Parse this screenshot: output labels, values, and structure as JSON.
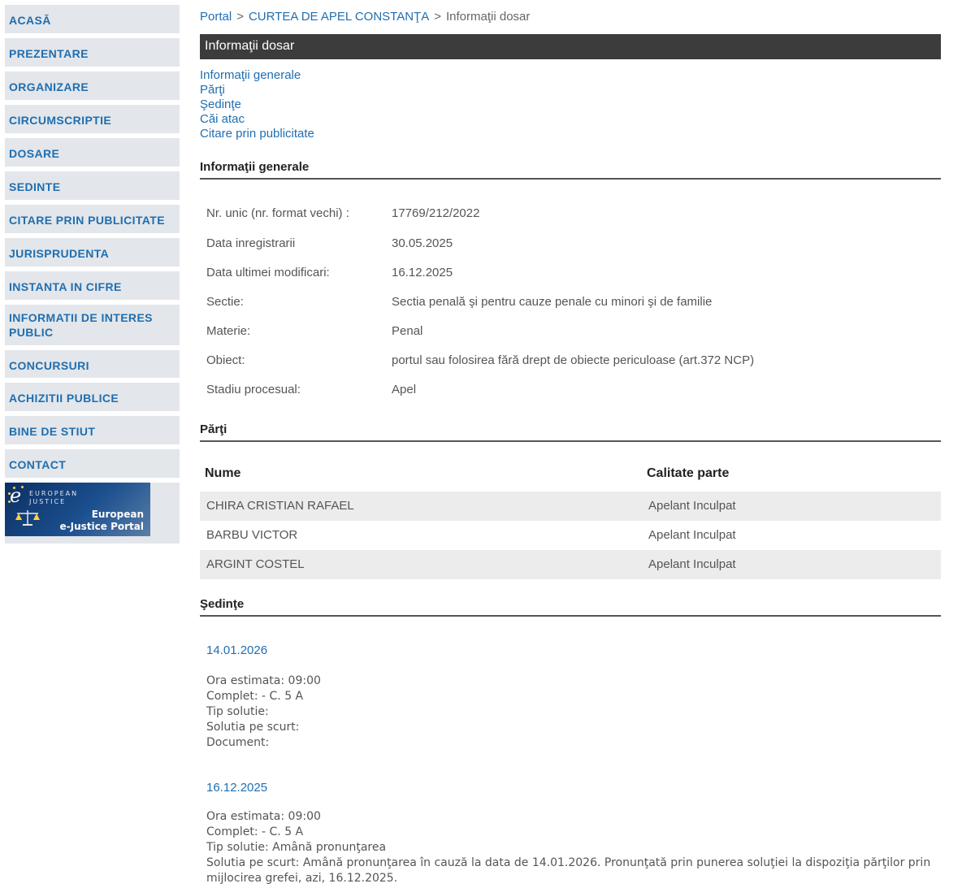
{
  "sidebar": {
    "items": [
      {
        "label": "ACASĂ"
      },
      {
        "label": "PREZENTARE"
      },
      {
        "label": "ORGANIZARE"
      },
      {
        "label": "CIRCUMSCRIPTIE"
      },
      {
        "label": "DOSARE"
      },
      {
        "label": "SEDINTE"
      },
      {
        "label": "CITARE PRIN PUBLICITATE"
      },
      {
        "label": "JURISPRUDENTA"
      },
      {
        "label": "INSTANTA IN CIFRE"
      },
      {
        "label": "INFORMATII DE INTERES PUBLIC"
      },
      {
        "label": "CONCURSURI"
      },
      {
        "label": "ACHIZITII PUBLICE"
      },
      {
        "label": "BINE DE STIUT"
      },
      {
        "label": "CONTACT"
      }
    ],
    "banner": {
      "line_small_1": "EUROPEAN",
      "line_small_2": "JUSTICE",
      "line1": "European",
      "line2": "e-Justice Portal"
    }
  },
  "breadcrumb": {
    "portal": "Portal",
    "court": "CURTEA DE APEL CONSTANŢA",
    "current": "Informaţii dosar",
    "separator": ">"
  },
  "page_title": "Informaţii dosar",
  "section_links": [
    "Informaţii generale",
    "Părţi",
    "Şedinţe",
    "Căi atac",
    "Citare prin publicitate"
  ],
  "general": {
    "heading": "Informaţii generale",
    "rows": [
      {
        "label": "Nr. unic (nr. format vechi) :",
        "value": "17769/212/2022"
      },
      {
        "label": "Data inregistrarii",
        "value": "30.05.2025"
      },
      {
        "label": "Data ultimei modificari:",
        "value": "16.12.2025"
      },
      {
        "label": "Sectie:",
        "value": "Sectia penală şi pentru cauze penale cu minori şi de familie"
      },
      {
        "label": "Materie:",
        "value": "Penal"
      },
      {
        "label": "Obiect:",
        "value": "portul sau folosirea fără drept de obiecte periculoase (art.372 NCP)"
      },
      {
        "label": "Stadiu procesual:",
        "value": "Apel"
      }
    ]
  },
  "parties": {
    "heading": "Părţi",
    "columns": [
      "Nume",
      "Calitate parte"
    ],
    "rows": [
      {
        "name": "CHIRA CRISTIAN RAFAEL",
        "role": "Apelant Inculpat"
      },
      {
        "name": "BARBU VICTOR",
        "role": "Apelant Inculpat"
      },
      {
        "name": "ARGINT COSTEL",
        "role": "Apelant Inculpat"
      }
    ]
  },
  "hearings": {
    "heading": "Şedinţe",
    "items": [
      {
        "date": "14.01.2026",
        "ora": "Ora estimata: 09:00",
        "complet": "Complet: - C. 5 A",
        "tip": "Tip solutie:",
        "solutia": "Solutia pe scurt:",
        "document": "Document:"
      },
      {
        "date": "16.12.2025",
        "ora": "Ora estimata: 09:00",
        "complet": "Complet: - C. 5 A",
        "tip": "Tip solutie: Amână pronunţarea",
        "solutia": "Solutia pe scurt: Amână pronunţarea în cauză la data de 14.01.2026. Pronunţată prin punerea soluţiei la dispoziţia părţilor prin mijlocirea grefei, azi, 16.12.2025."
      }
    ]
  },
  "colors": {
    "link": "#1f6eb0",
    "sidebar_bg": "#e3e6ea",
    "title_bar": "#3c3c3c",
    "row_shade": "#ececec"
  }
}
